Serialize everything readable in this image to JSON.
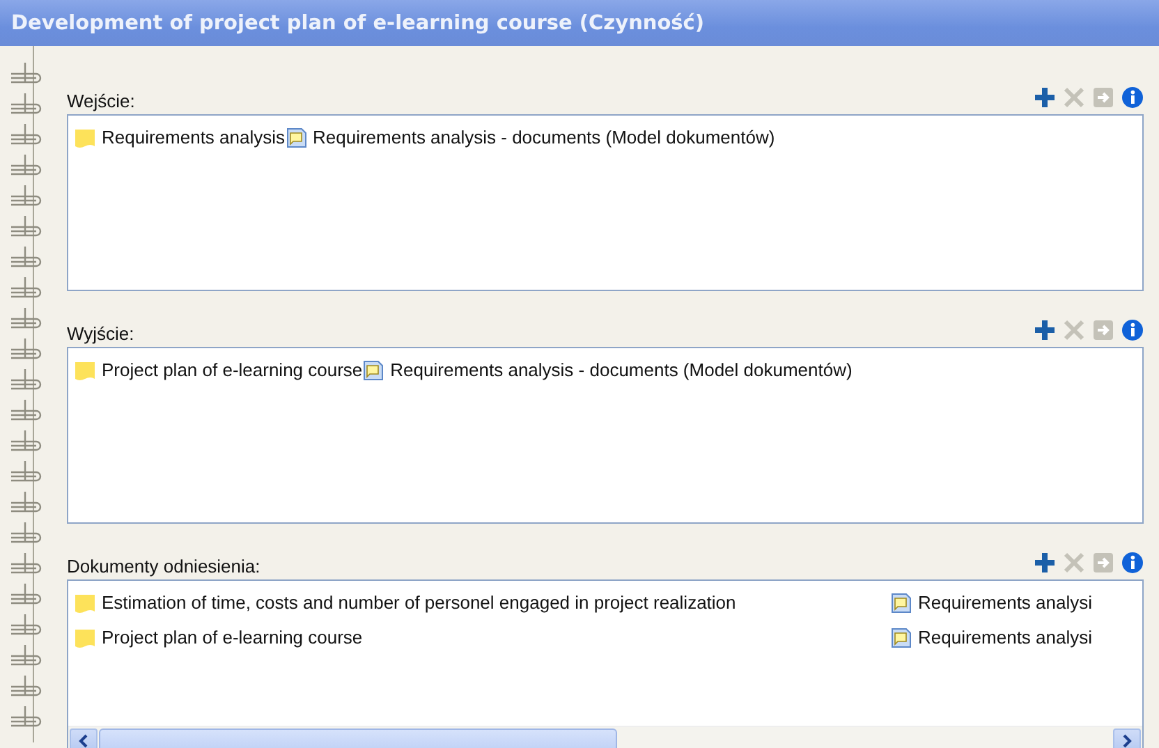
{
  "window": {
    "title": "Development of project plan of e-learning course (Czynność)"
  },
  "sections": [
    {
      "label": "Wejście:",
      "kind": "flow",
      "tools": [
        {
          "kind": "add",
          "disabled": false
        },
        {
          "kind": "delete",
          "disabled": true
        },
        {
          "kind": "open",
          "disabled": true
        },
        {
          "kind": "info",
          "disabled": false
        }
      ],
      "rows": [
        {
          "name": "Requirements analysis",
          "document": "Requirements analysis - documents (Model dokumentów)"
        }
      ]
    },
    {
      "label": "Wyjście:",
      "kind": "flow",
      "tools": [
        {
          "kind": "add",
          "disabled": false
        },
        {
          "kind": "delete",
          "disabled": true
        },
        {
          "kind": "open",
          "disabled": true
        },
        {
          "kind": "info",
          "disabled": false
        }
      ],
      "rows": [
        {
          "name": "Project plan of e-learning course",
          "document": "Requirements analysis - documents (Model dokumentów)"
        }
      ]
    },
    {
      "label": "Dokumenty odniesienia:",
      "kind": "columns",
      "tools": [
        {
          "kind": "add",
          "disabled": false
        },
        {
          "kind": "delete",
          "disabled": true
        },
        {
          "kind": "open",
          "disabled": true
        },
        {
          "kind": "info",
          "disabled": false
        }
      ],
      "rows": [
        {
          "name": "Estimation of time, costs and number of personel engaged in project realization",
          "document": "Requirements analysi"
        },
        {
          "name": "Project plan of e-learning course",
          "document": "Requirements analysi"
        }
      ]
    }
  ]
}
